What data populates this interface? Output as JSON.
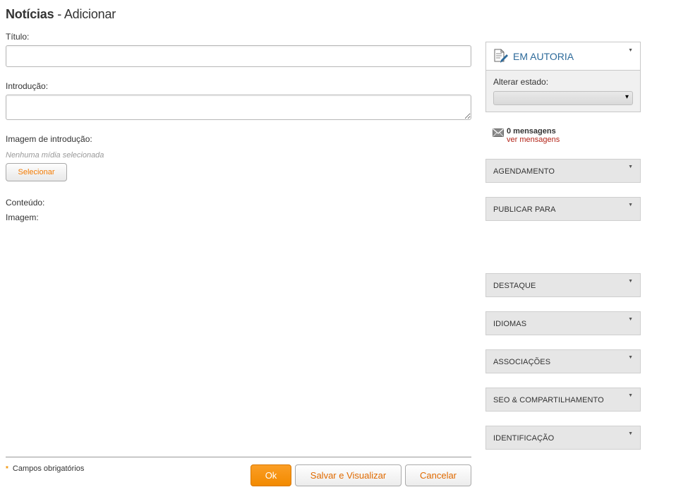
{
  "header": {
    "title_bold": "Notícias",
    "title_rest": " - Adicionar"
  },
  "form": {
    "titulo_label": "Título:",
    "titulo_value": "",
    "intro_label": "Introdução:",
    "intro_value": "",
    "intro_image_label": "Imagem de introdução:",
    "no_media_text": "Nenhuma mídia selecionada",
    "select_button": "Selecionar",
    "conteudo_label": "Conteúdo:",
    "imagem_label": "Imagem:"
  },
  "footer": {
    "required_star": "*",
    "required_text": "Campos obrigatórios",
    "ok_button": "Ok",
    "save_view_button": "Salvar e Visualizar",
    "cancel_button": "Cancelar"
  },
  "sidebar": {
    "status": {
      "title": "EM AUTORIA",
      "change_label": "Alterar estado:",
      "selected_value": ""
    },
    "messages": {
      "count_text": "0 mensagens",
      "link_text": "ver mensagens"
    },
    "panels": [
      {
        "label": "AGENDAMENTO"
      },
      {
        "label": "PUBLICAR PARA"
      },
      {
        "label": "DESTAQUE"
      },
      {
        "label": "IDIOMAS"
      },
      {
        "label": "ASSOCIAÇÕES"
      },
      {
        "label": "SEO & COMPARTILHAMENTO"
      },
      {
        "label": "IDENTIFICAÇÃO"
      }
    ],
    "caret_glyph": "▼",
    "select_arrow": "▾"
  },
  "colors": {
    "accent": "#f28a00",
    "link": "#b32418",
    "status_title": "#2d6a9a"
  }
}
